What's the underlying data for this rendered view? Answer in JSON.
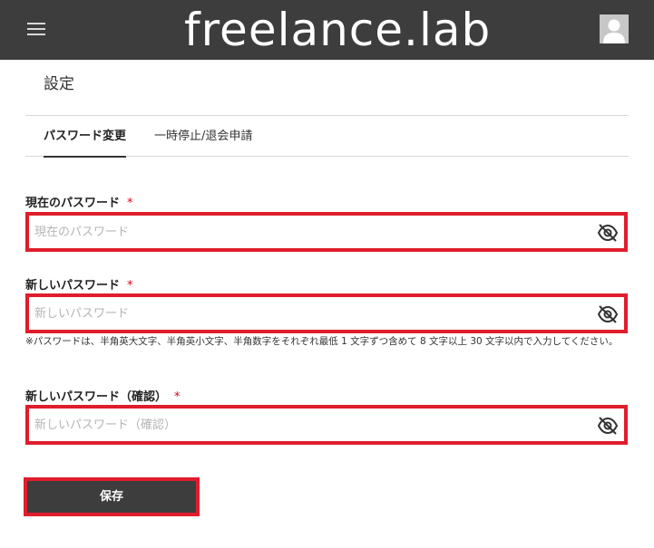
{
  "header": {
    "logo_text": "freelance.lab"
  },
  "page": {
    "title": "設定"
  },
  "tabs": [
    {
      "label": "パスワード変更",
      "active": true
    },
    {
      "label": "一時停止/退会申請",
      "active": false
    }
  ],
  "form": {
    "current_password": {
      "label": "現在のパスワード",
      "required_mark": "*",
      "placeholder": "現在のパスワード",
      "value": ""
    },
    "new_password": {
      "label": "新しいパスワード",
      "required_mark": "*",
      "placeholder": "新しいパスワード",
      "value": "",
      "hint": "※パスワードは、半角英大文字、半角英小文字、半角数字をそれぞれ最低 1 文字ずつ含めて 8 文字以上 30 文字以内で入力してください。"
    },
    "confirm_password": {
      "label": "新しいパスワード（確認）",
      "required_mark": "*",
      "placeholder": "新しいパスワード（確認）",
      "value": ""
    },
    "save_label": "保存"
  },
  "icons": {
    "menu": "hamburger-menu-icon",
    "avatar": "user-avatar-icon",
    "visibility": "eye-off-icon"
  },
  "colors": {
    "header_bg": "#3d3d3d",
    "highlight_border": "#e01d2c",
    "required": "#d9001b",
    "button_bg": "#3d3d3d"
  }
}
